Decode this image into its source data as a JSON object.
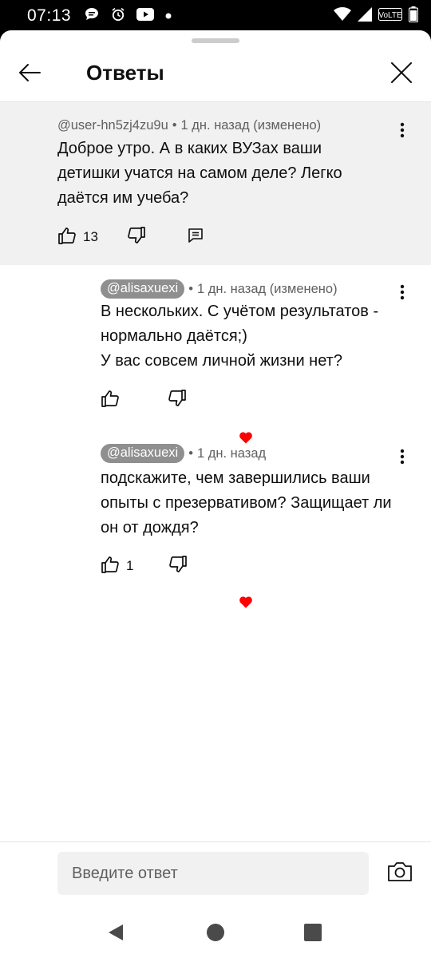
{
  "status_bar": {
    "time": "07:13",
    "left_icons": [
      "chat-bubble-icon",
      "alarm-icon",
      "youtube-icon",
      "dot-icon"
    ],
    "right_icons": [
      "wifi-icon",
      "signal-icon",
      "volte-icon",
      "battery-icon"
    ],
    "volte_label": "VoLTE"
  },
  "header": {
    "title": "Ответы",
    "back_icon": "arrow-left-icon",
    "close_icon": "close-icon"
  },
  "parent_comment": {
    "author": "@user-hn5zj4zu9u",
    "time": "1 дн. назад (изменено)",
    "text": "Доброе утро. А в каких ВУЗах ваши детишки учатся на самом деле? Легко даётся им учеба?",
    "likes": "13"
  },
  "replies": [
    {
      "author": "@alisaxuexi",
      "time": "1 дн. назад (изменено)",
      "text": "В нескольких. С учётом результатов - нормально даётся;)\nУ вас совсем личной жизни нет?",
      "likes": "",
      "hearted": true
    },
    {
      "author": "@alisaxuexi",
      "time": "1 дн. назад",
      "text": "подскажите, чем завершились ваши опыты с презервативом? Защищает ли он от дождя?",
      "likes": "1",
      "hearted": true
    }
  ],
  "reply_bar": {
    "placeholder": "Введите ответ"
  },
  "colors": {
    "heart": "#ff0000",
    "parent_bg": "#f1f1f1",
    "chip_bg": "#8f8f8f"
  },
  "nav": [
    "back-triangle-icon",
    "home-circle-icon",
    "recents-square-icon"
  ]
}
